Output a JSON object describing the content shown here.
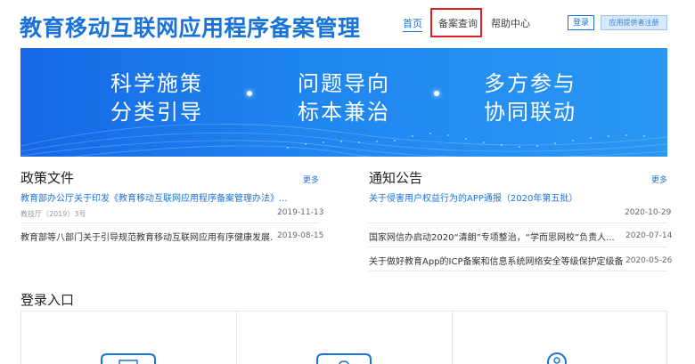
{
  "header": {
    "title": "教育移动互联网应用程序备案管理",
    "nav": [
      {
        "label": "首页",
        "active": true
      },
      {
        "label": "备案查询",
        "active": false
      },
      {
        "label": "帮助中心",
        "active": false
      }
    ],
    "login_label": "登录",
    "register_label": "应用提供者注册"
  },
  "banner": {
    "slogans": [
      {
        "line1": "科学施策",
        "line2": "分类引导"
      },
      {
        "line1": "问题导向",
        "line2": "标本兼治"
      },
      {
        "line1": "多方参与",
        "line2": "协同联动"
      }
    ]
  },
  "policy": {
    "title": "政策文件",
    "more": "更多",
    "items": [
      {
        "title": "教育部办公厅关于印发《教育移动互联网应用程序备案管理办法》...",
        "meta": "教技厅（2019）3号",
        "date": "2019-11-13"
      },
      {
        "title": "教育部等八部门关于引导规范教育移动互联网应用有序健康发展...",
        "meta": "",
        "date": "2019-08-15"
      }
    ]
  },
  "notice": {
    "title": "通知公告",
    "more": "更多",
    "items": [
      {
        "title": "关于侵害用户权益行为的APP通报（2020年第五批）",
        "date": "2020-10-29"
      },
      {
        "title": "国家网信办启动2020“清朗”专项整治，“学而思网校”负责人...",
        "date": "2020-07-14"
      },
      {
        "title": "关于做好教育App的ICP备案和信息系统网络安全等级保护定级备...",
        "date": "2020-05-26"
      }
    ]
  },
  "login": {
    "title": "登录入口"
  },
  "colors": {
    "brand": "#1a73d9",
    "highlight": "#e02020"
  }
}
